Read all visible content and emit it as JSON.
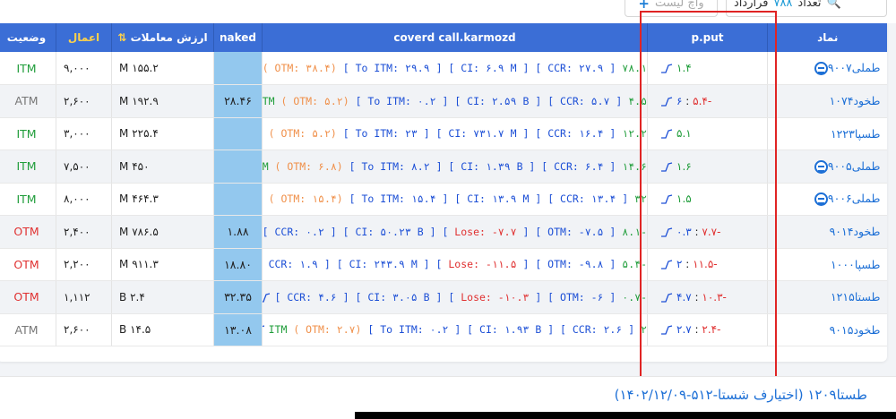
{
  "toolbar": {
    "watch_label": "واچ لیست",
    "contracts_label": "قرارداد",
    "count_value": "۷۸۸",
    "count_label": "تعداد"
  },
  "table": {
    "headers": {
      "symbol": "نماد",
      "pput": "p.put",
      "covered_call": "coverd call.karmozd",
      "naked": "naked",
      "value": "ارزش معاملات",
      "strike": "اعمال",
      "status": "وضعیت"
    },
    "rows": [
      {
        "symbol": "طملی۹۰۰۷",
        "icon": true,
        "pput_a": "۱.۴",
        "pput_b": "",
        "pput_b_color": "blu",
        "pput_a_color": "grn",
        "cc": [
          [
            "۷۸.۱ ITM",
            "grn"
          ],
          [
            " ( ",
            "org"
          ],
          [
            "OTM: ۳۸.۴",
            "org"
          ],
          [
            ") ",
            "org"
          ],
          [
            "[ To ITM: ۲۹.۹ ] [ CI: ۶.۹ M ] [ CCR: ۲۷.۹ ]",
            "blu"
          ]
        ],
        "naked": "",
        "value": "۱۵۵.۲ M",
        "strike": "۹,۰۰۰",
        "status": "ITM",
        "status_color": "grn"
      },
      {
        "symbol": "طخود۱۰۷۴",
        "icon": false,
        "pput_a": "-۵.۴",
        "pput_b": "۶",
        "pput_a_color": "red",
        "pput_b_color": "blu",
        "cc": [
          [
            "۴.۵ ITM",
            "grn"
          ],
          [
            " ( OTM: ۵.۲) ",
            "org"
          ],
          [
            "[ To ITM: ۰.۲ ] [ CI: ۲.۵۹ B ] [ CCR: ۵.۷ ]",
            "blu"
          ]
        ],
        "naked": "۲۸.۴۶",
        "value": "۱۹۲.۹ M",
        "strike": "۲,۶۰۰",
        "status": "ATM",
        "status_color": "gry"
      },
      {
        "symbol": "طسپا۱۲۲۳",
        "icon": false,
        "pput_a": "۵.۱",
        "pput_b": "",
        "pput_a_color": "grn",
        "pput_b_color": "blu",
        "cc": [
          [
            "۱۲.۲ ITM",
            "grn"
          ],
          [
            " ( OTM: ۵.۲) ",
            "org"
          ],
          [
            "[ To ITM: ۲۳ ] [ CI: ۷۳۱.۷ M ] [ CCR: ۱۶.۴ ]",
            "blu"
          ]
        ],
        "naked": "",
        "value": "۲۲۵.۴ M",
        "strike": "۳,۰۰۰",
        "status": "ITM",
        "status_color": "grn"
      },
      {
        "symbol": "طملی۹۰۰۵",
        "icon": true,
        "pput_a": "۱.۶",
        "pput_b": "",
        "pput_a_color": "grn",
        "pput_b_color": "blu",
        "cc": [
          [
            "۱۴.۶ ITM",
            "grn"
          ],
          [
            " ( OTM: ۶.۸) ",
            "org"
          ],
          [
            "[ To ITM: ۸.۲ ] [ CI: ۱.۳۹ B ] [ CCR: ۶.۴ ]",
            "blu"
          ]
        ],
        "naked": "",
        "value": "۴۵۰ M",
        "strike": "۷,۵۰۰",
        "status": "ITM",
        "status_color": "grn"
      },
      {
        "symbol": "طملی۹۰۰۶",
        "icon": true,
        "pput_a": "۱.۵",
        "pput_b": "",
        "pput_a_color": "grn",
        "pput_b_color": "blu",
        "cc": [
          [
            "۳۲ ITM",
            "grn"
          ],
          [
            " ( OTM: ۱۵.۴) ",
            "org"
          ],
          [
            "[ To ITM: ۱۵.۴ ] [ CI: ۱۳.۹ M ] [ CCR: ۱۳.۴ ]",
            "blu"
          ]
        ],
        "naked": "",
        "value": "۴۶۴.۳ M",
        "strike": "۸,۰۰۰",
        "status": "ITM",
        "status_color": "grn"
      },
      {
        "symbol": "طخود۹۰۱۴",
        "icon": false,
        "pput_a": "-۷.۷",
        "pput_b": "۰.۳",
        "pput_a_color": "red",
        "pput_b_color": "blu",
        "cc": [
          [
            "-۸.۱ ",
            "grn"
          ],
          [
            "[ OTM: -۷.۵ ] [ ",
            "blu"
          ],
          [
            "Lose: -۷.۷",
            "red"
          ],
          [
            " ] [ CI: ۵۰.۲۳ B ] [ CCR: ۰.۲ ]",
            "blu"
          ]
        ],
        "naked": "۱.۸۸",
        "value": "۷۸۶.۵ M",
        "strike": "۲,۴۰۰",
        "status": "OTM",
        "status_color": "red"
      },
      {
        "symbol": "طسپا۱۰۰۰",
        "icon": false,
        "pput_a": "-۱۱.۵",
        "pput_b": "۲",
        "pput_a_color": "red",
        "pput_b_color": "blu",
        "cc": [
          [
            "-۵.۴ ",
            "grn"
          ],
          [
            "[ OTM: -۹.۸ ] [ ",
            "blu"
          ],
          [
            "Lose: -۱۱.۵",
            "red"
          ],
          [
            " ] [ CI: ۲۴۳.۹ M ] [ CCR: ۱.۹ ]",
            "blu"
          ]
        ],
        "naked": "۱۸.۸۰",
        "value": "۹۱۱.۳ M",
        "strike": "۲,۲۰۰",
        "status": "OTM",
        "status_color": "red"
      },
      {
        "symbol": "طستا۱۲۱۵",
        "icon": false,
        "pput_a": "-۱۰.۳",
        "pput_b": "۴.۷",
        "pput_a_color": "red",
        "pput_b_color": "blu",
        "cc": [
          [
            "-۰.۷ ",
            "grn"
          ],
          [
            "[ OTM: -۶ ] [ ",
            "blu"
          ],
          [
            "Lose: -۱۰.۳",
            "red"
          ],
          [
            " ] [ CI: ۳.۰۵ B ] [ CCR: ۴.۶ ]",
            "blu"
          ]
        ],
        "naked": "۳۲.۳۵",
        "value": "۲.۴ B",
        "strike": "۱,۱۱۲",
        "status": "OTM",
        "status_color": "red"
      },
      {
        "symbol": "طخود۹۰۱۵",
        "icon": false,
        "pput_a": "-۲.۴",
        "pput_b": "۲.۷",
        "pput_a_color": "red",
        "pput_b_color": "blu",
        "cc": [
          [
            "۲ ITM",
            "grn"
          ],
          [
            " ( OTM: ۲.۷) ",
            "org"
          ],
          [
            "[ To ITM: ۰.۲ ] [ CI: ۱.۹۳ B ] [ CCR: ۲.۶ ]",
            "blu"
          ]
        ],
        "naked": "۱۳.۰۸",
        "value": "۱۴.۵ B",
        "strike": "۲,۶۰۰",
        "status": "ATM",
        "status_color": "gry"
      }
    ]
  },
  "bottom": {
    "title": "طستا۱۲۰۹ (اختیارف شستا-۵۱۲-۱۴۰۲/۱۲/۰۹)"
  }
}
